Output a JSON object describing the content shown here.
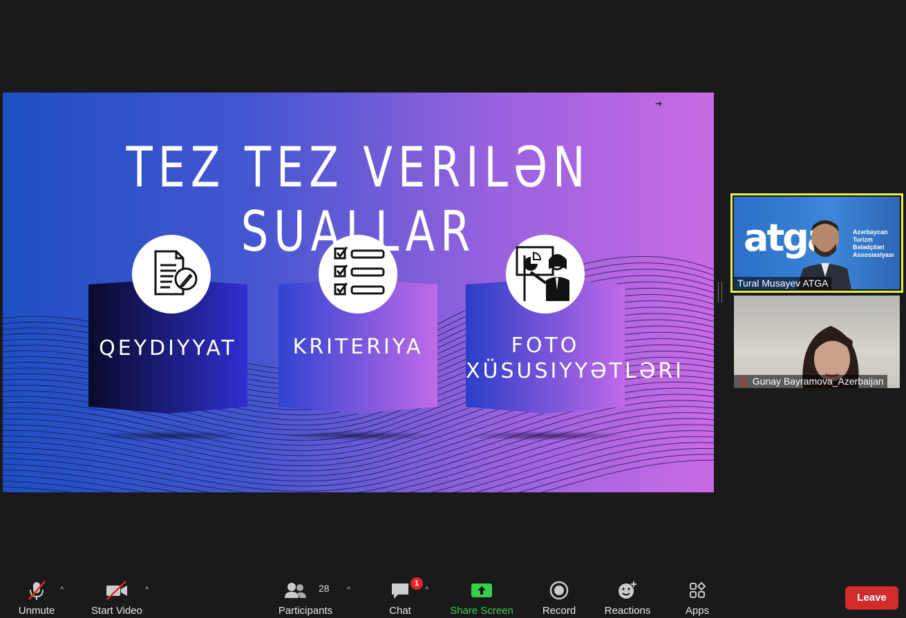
{
  "slide": {
    "title": "TEZ TEZ VERILƏN SUALLAR",
    "cards": [
      {
        "label": "QEYDIYYAT",
        "icon": "form-pen-icon"
      },
      {
        "label": "KRITERIYA",
        "icon": "checklist-icon"
      },
      {
        "label_line1": "FOTO",
        "label_line2": "XÜSUSIYYƏTLƏRI",
        "icon": "presenter-icon"
      }
    ]
  },
  "participants_panel": [
    {
      "name": "Tural Musayev ATGA",
      "logo": "atga",
      "org_line1": "Azərbaycan",
      "org_line2": "Turizm",
      "org_line3": "Bələdçiləri",
      "org_line4": "Assosiasiyası",
      "muted": false,
      "active_speaker": true
    },
    {
      "name": "Gunay Bayramova_Azerbaijan",
      "muted": true,
      "active_speaker": false
    }
  ],
  "toolbar": {
    "unmute": "Unmute",
    "start_video": "Start Video",
    "participants": "Participants",
    "participants_count": "28",
    "chat": "Chat",
    "chat_badge": "1",
    "share_screen": "Share Screen",
    "record": "Record",
    "reactions": "Reactions",
    "apps": "Apps",
    "leave": "Leave"
  },
  "colors": {
    "leave": "#d12b2b",
    "share_green": "#37d04c",
    "active_outline": "#e8f04a",
    "badge_red": "#e02828"
  }
}
